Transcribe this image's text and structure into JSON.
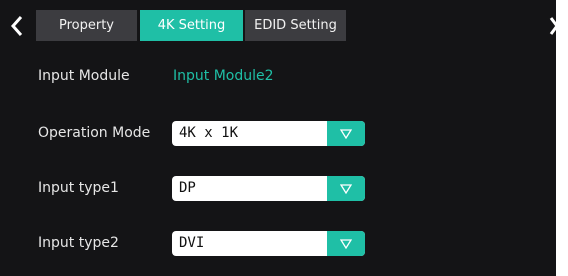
{
  "tabs": [
    {
      "label": "Property",
      "active": false
    },
    {
      "label": "4K Setting",
      "active": true
    },
    {
      "label": "EDID Setting",
      "active": false
    }
  ],
  "icons": {
    "back": "chevron-left-icon",
    "next": "chevron-right-icon",
    "dropdown": "triangle-down-icon"
  },
  "colors": {
    "accent": "#1fbfa6",
    "background": "#141416",
    "tab_inactive": "#3c3c40"
  },
  "form": {
    "input_module": {
      "label": "Input Module",
      "value": "Input Module2"
    },
    "operation_mode": {
      "label": "Operation Mode",
      "value": "4K x 1K"
    },
    "input_type1": {
      "label": "Input type1",
      "value": "DP"
    },
    "input_type2": {
      "label": "Input type2",
      "value": "DVI"
    }
  }
}
